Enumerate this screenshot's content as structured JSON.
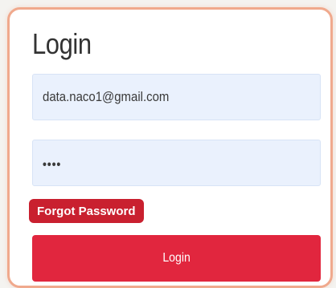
{
  "login_form": {
    "title": "Login",
    "email_value": "data.naco1@gmail.com",
    "password_value": "••••",
    "forgot_password_label": "Forgot Password",
    "submit_label": "Login"
  },
  "colors": {
    "card_border": "#f0a98d",
    "input_background": "#eaf1fd",
    "forgot_background": "#c9202f",
    "button_background": "#e1263e"
  }
}
